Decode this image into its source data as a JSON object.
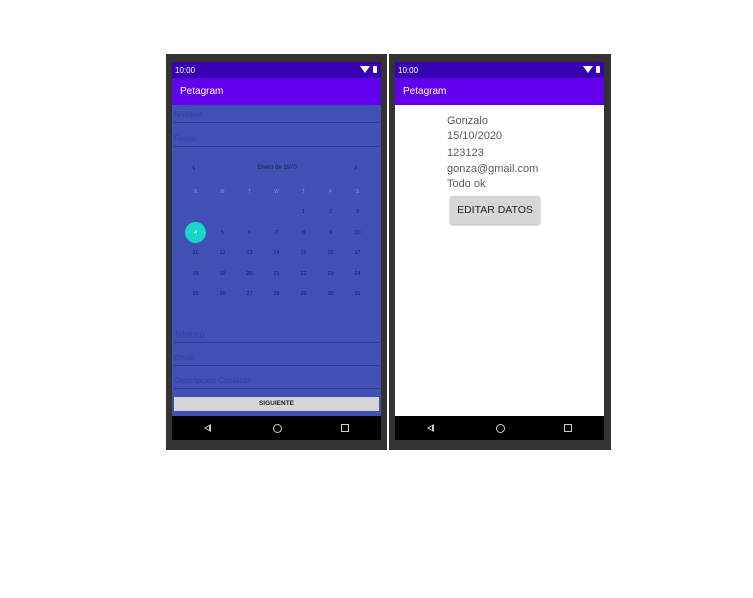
{
  "status_time": "10:00",
  "app_title": "Petagram",
  "form": {
    "nombre_placeholder": "Nombre",
    "fecha_placeholder": "Fecha",
    "telefono_placeholder": "Telefono",
    "email_placeholder": "Email",
    "descripcion_placeholder": "Descripcion Contacto",
    "siguiente_label": "SIGUIENTE"
  },
  "calendar": {
    "month_title": "Enero de 1970",
    "days_of_week": [
      "S",
      "M",
      "T",
      "W",
      "T",
      "F",
      "S"
    ],
    "weeks": [
      [
        "",
        "",
        "",
        "",
        "1",
        "2",
        "3"
      ],
      [
        "4",
        "5",
        "6",
        "7",
        "8",
        "9",
        "10"
      ],
      [
        "11",
        "12",
        "13",
        "14",
        "15",
        "16",
        "17"
      ],
      [
        "18",
        "19",
        "20",
        "21",
        "22",
        "23",
        "24"
      ],
      [
        "25",
        "26",
        "27",
        "28",
        "29",
        "30",
        "31"
      ]
    ],
    "selected_day": "4"
  },
  "details": {
    "name": "Gonzalo",
    "date": "15/10/2020",
    "phone": "123123",
    "email": "gonza@gmail.com",
    "description": "Todo ok",
    "edit_label": "EDITAR DATOS"
  },
  "colors": {
    "status_bar": "#3700b3",
    "app_bar": "#6200ee",
    "form_background": "#3f51b5",
    "selected_day": "#18d7c8"
  },
  "icons": {
    "back": "triangle-left",
    "home": "circle",
    "recents": "square"
  }
}
